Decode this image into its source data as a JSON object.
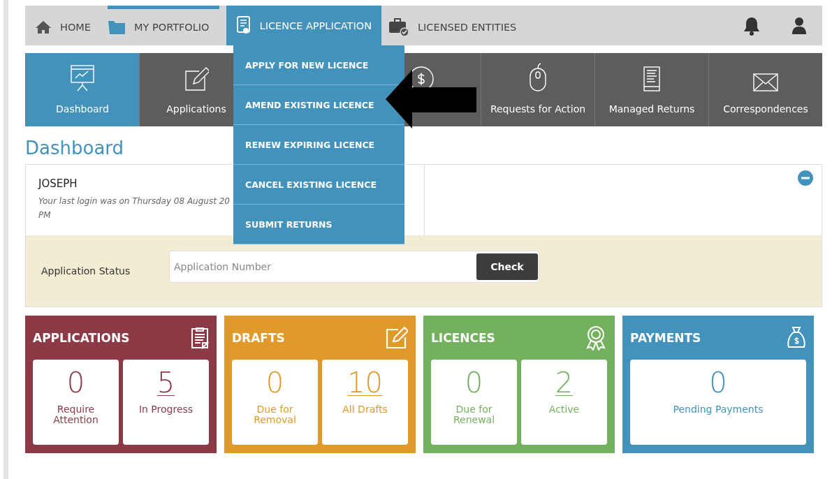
{
  "top_nav": {
    "items": [
      {
        "label": "HOME",
        "selected": false,
        "highlighted": false
      },
      {
        "label": "MY PORTFOLIO",
        "selected": false,
        "highlighted": true
      },
      {
        "label": "LICENCE APPLICATION",
        "selected": true,
        "highlighted": false
      },
      {
        "label": "LICENSED ENTITIES",
        "selected": false,
        "highlighted": false
      }
    ]
  },
  "dropdown": {
    "items": [
      "APPLY FOR NEW LICENCE",
      "AMEND EXISTING LICENCE",
      "RENEW EXPIRING LICENCE",
      "CANCEL EXISTING LICENCE",
      "SUBMIT RETURNS"
    ]
  },
  "tiles": [
    {
      "label": "Dashboard",
      "selected": true
    },
    {
      "label": "Applications",
      "selected": false
    },
    {
      "selected": false
    },
    {
      "label": "Requests for Action",
      "selected": false
    },
    {
      "label": "Managed Returns",
      "selected": false
    },
    {
      "label": "Correspondences",
      "selected": false
    }
  ],
  "page_title": "Dashboard",
  "user": {
    "name": "JOSEPH",
    "login_lines": [
      "Your last login was on Thursday 08 August 20",
      "PM"
    ]
  },
  "status_check": {
    "label": "Application Status",
    "placeholder": "Application Number",
    "button": "Check"
  },
  "cards": [
    {
      "title": "APPLICATIONS",
      "color": "#8b3a46",
      "stats": [
        {
          "value": "0",
          "label": "Require Attention",
          "link": false
        },
        {
          "value": "5",
          "label": "In Progress",
          "link": true
        }
      ]
    },
    {
      "title": "DRAFTS",
      "color": "#e09a2a",
      "stats": [
        {
          "value": "0",
          "label": "Due for Removal",
          "link": false
        },
        {
          "value": "10",
          "label": "All Drafts",
          "link": true
        }
      ]
    },
    {
      "title": "LICENCES",
      "color": "#74b15e",
      "stats": [
        {
          "value": "0",
          "label": "Due for Renewal",
          "link": false
        },
        {
          "value": "2",
          "label": "Active",
          "link": true
        }
      ]
    },
    {
      "title": "PAYMENTS",
      "color": "#4292bc",
      "stats": [
        {
          "value": "0",
          "label": "Pending Payments",
          "link": false
        }
      ]
    }
  ]
}
